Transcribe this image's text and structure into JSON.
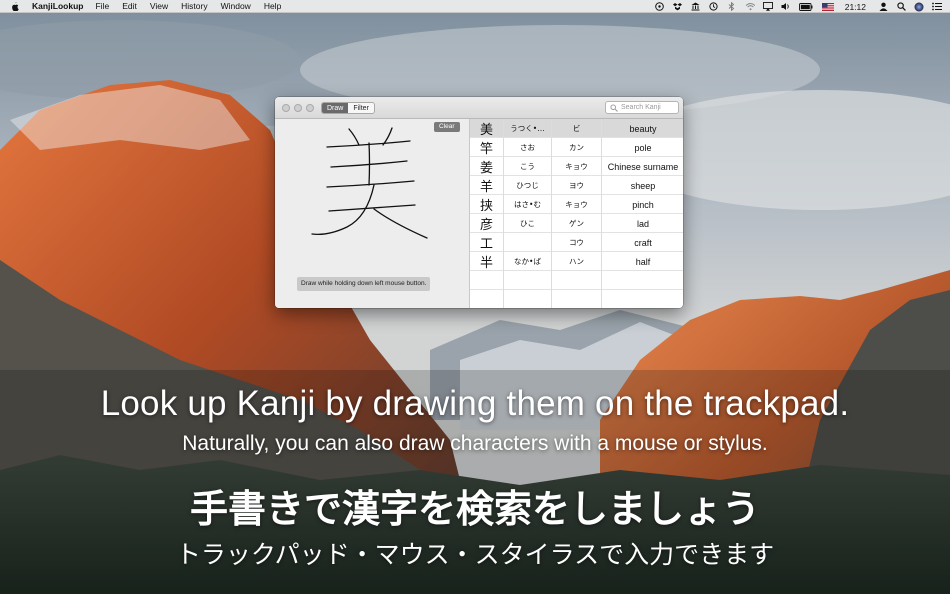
{
  "menubar": {
    "app_name": "KanjiLookup",
    "menus": [
      "File",
      "Edit",
      "View",
      "History",
      "Window",
      "Help"
    ],
    "clock": "21:12",
    "status_icons": [
      "cloudapp-icon",
      "dropbox-icon",
      "bank-icon",
      "time-machine-icon",
      "bluetooth-icon",
      "wifi-icon",
      "airplay-icon",
      "volume-icon",
      "battery-icon",
      "flag-us-icon",
      "user-icon",
      "spotlight-icon",
      "siri-icon",
      "notification-center-icon"
    ]
  },
  "window": {
    "tabs": [
      {
        "label": "Draw",
        "active": true
      },
      {
        "label": "Filter",
        "active": false
      }
    ],
    "search_placeholder": "Search Kanji",
    "clear_label": "Clear",
    "hint": "Draw while holding down left mouse button.",
    "results": [
      {
        "kanji": "美",
        "kun": "うつく•…",
        "on": "ビ",
        "meaning": "beauty",
        "selected": true
      },
      {
        "kanji": "竿",
        "kun": "さお",
        "on": "カン",
        "meaning": "pole",
        "selected": false
      },
      {
        "kanji": "姜",
        "kun": "こう",
        "on": "キョウ",
        "meaning": "Chinese surname",
        "selected": false
      },
      {
        "kanji": "羊",
        "kun": "ひつじ",
        "on": "ヨウ",
        "meaning": "sheep",
        "selected": false
      },
      {
        "kanji": "挟",
        "kun": "はさ•む",
        "on": "キョウ",
        "meaning": "pinch",
        "selected": false
      },
      {
        "kanji": "彦",
        "kun": "ひこ",
        "on": "ゲン",
        "meaning": "lad",
        "selected": false
      },
      {
        "kanji": "工",
        "kun": "",
        "on": "コウ",
        "meaning": "craft",
        "selected": false
      },
      {
        "kanji": "半",
        "kun": "なか•ば",
        "on": "ハン",
        "meaning": "half",
        "selected": false
      }
    ]
  },
  "captions": {
    "line1": "Look up Kanji by drawing them on the trackpad.",
    "line2": "Naturally, you can also draw characters with a mouse or stylus.",
    "line3": "手書きで漢字を検索をしましょう",
    "line4": "トラックパッド・マウス・スタイラスで入力できます"
  },
  "colors": {
    "selected_row": "#d9d9d9",
    "active_tab": "#6a6a6a",
    "caption_text": "#ffffff"
  }
}
